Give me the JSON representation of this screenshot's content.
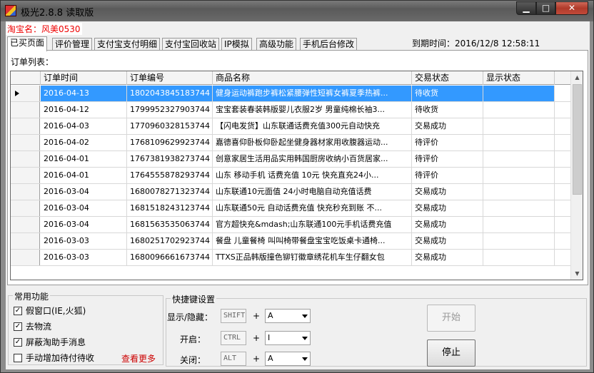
{
  "window": {
    "title": "极光2.8.8  读取版",
    "controls": {
      "minimize": "▁",
      "maximize": "□",
      "close": "✕"
    }
  },
  "shop": {
    "label": "淘宝名：风美0530"
  },
  "tabs": [
    {
      "label": "已买页面",
      "active": true
    },
    {
      "label": "评价管理"
    },
    {
      "label": "支付宝支付明细"
    },
    {
      "label": "支付宝回收站"
    },
    {
      "label": "IP模拟"
    },
    {
      "label": "高级功能"
    },
    {
      "label": "手机后台修改"
    }
  ],
  "expire": {
    "text": "到期时间：2016/12/8 12:58:11"
  },
  "orders": {
    "caption": "订单列表：",
    "columns": [
      "订单时间",
      "订单编号",
      "商品名称",
      "交易状态",
      "显示状态"
    ],
    "rows": [
      {
        "date": "2016-04-13",
        "id": "1802043845183744",
        "name": "健身运动裤跑步裤松紧腰弹性短裤女裤夏季热裤...",
        "status": "待收货",
        "show": "",
        "selected": true
      },
      {
        "date": "2016-04-12",
        "id": "1799952327903744",
        "name": "宝宝套装春装韩版婴儿衣服2岁 男童纯棉长袖3...",
        "status": "待收货",
        "show": ""
      },
      {
        "date": "2016-04-03",
        "id": "1770960328153744",
        "name": "【闪电发货】山东联通话费充值300元自动快充",
        "status": "交易成功",
        "show": ""
      },
      {
        "date": "2016-04-02",
        "id": "1768109629923744",
        "name": "嘉德喜仰卧板仰卧起坐健身器材家用收腹器运动...",
        "status": "待评价",
        "show": ""
      },
      {
        "date": "2016-04-01",
        "id": "1767381938273744",
        "name": "创意家居生活用品实用韩国厨房收纳小百货居家...",
        "status": "待评价",
        "show": ""
      },
      {
        "date": "2016-04-01",
        "id": "1764555878293744",
        "name": "山东  移动手机 话费充值 10元 快充直充24小...",
        "status": "待评价",
        "show": ""
      },
      {
        "date": "2016-03-04",
        "id": "1680078271323744",
        "name": "山东联通10元面值 24小时电脑自动充值话费",
        "status": "交易成功",
        "show": ""
      },
      {
        "date": "2016-03-04",
        "id": "1681518243123744",
        "name": "山东联通50元 自动话费充值 快充秒充到账 不...",
        "status": "交易成功",
        "show": ""
      },
      {
        "date": "2016-03-04",
        "id": "1681563535063744",
        "name": "官方超快充&mdash;山东联通100元手机话费充值",
        "status": "交易成功",
        "show": ""
      },
      {
        "date": "2016-03-03",
        "id": "1680251702923744",
        "name": "餐盘 儿童餐椅 叫叫椅带餐盘宝宝吃饭桌卡通椅...",
        "status": "交易成功",
        "show": ""
      },
      {
        "date": "2016-03-03",
        "id": "1680096661673744",
        "name": "TTXS正品韩版撞色铆钉徽章绣花机车生仔翻女包",
        "status": "交易成功",
        "show": ""
      }
    ]
  },
  "common": {
    "title": "常用功能",
    "options": [
      {
        "label": "假窗口(IE,火狐)",
        "checked": true
      },
      {
        "label": "去物流",
        "checked": true
      },
      {
        "label": "屏蔽淘助手消息",
        "checked": true
      },
      {
        "label": "手动增加待付待收",
        "checked": false
      }
    ],
    "more": "查看更多"
  },
  "hotkeys": {
    "title": "快捷键设置",
    "items": [
      {
        "label": "显示/隐藏：",
        "modifier": "SHIFT",
        "key": "A"
      },
      {
        "label": "开启：",
        "modifier": "CTRL",
        "key": "I"
      },
      {
        "label": "关闭：",
        "modifier": "ALT",
        "key": "A"
      }
    ],
    "start": "开始",
    "stop": "停止"
  }
}
